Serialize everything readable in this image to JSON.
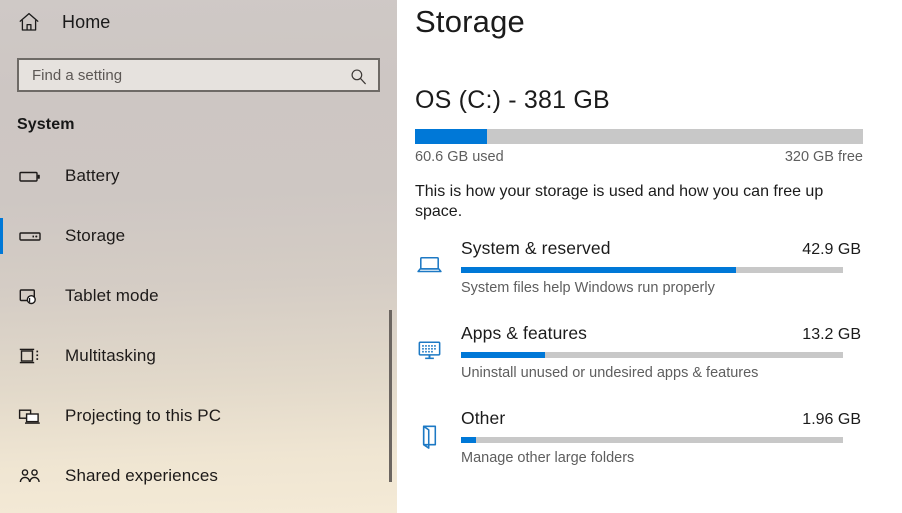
{
  "colors": {
    "accent": "#0078d7",
    "track": "#c8c8c8",
    "text": "#1b1b1b",
    "muted": "#5e5e5e"
  },
  "sidebar": {
    "home_label": "Home",
    "search": {
      "placeholder": "Find a setting",
      "value": ""
    },
    "section_title": "System",
    "items": [
      {
        "label": "Battery",
        "icon": "battery-icon",
        "selected": false
      },
      {
        "label": "Storage",
        "icon": "storage-icon",
        "selected": true
      },
      {
        "label": "Tablet mode",
        "icon": "tablet-mode-icon",
        "selected": false
      },
      {
        "label": "Multitasking",
        "icon": "multitasking-icon",
        "selected": false
      },
      {
        "label": "Projecting to this PC",
        "icon": "projecting-icon",
        "selected": false
      },
      {
        "label": "Shared experiences",
        "icon": "shared-icon",
        "selected": false
      }
    ]
  },
  "content": {
    "page_title": "Storage",
    "drive": {
      "title": "OS (C:) - 381 GB",
      "used_label": "60.6 GB used",
      "free_label": "320 GB free",
      "fill_percent": 16
    },
    "blurb": "This is how your storage is used and how you can free up space.",
    "categories": [
      {
        "name": "System & reserved",
        "size": "42.9 GB",
        "description": "System files help Windows run properly",
        "fill_percent": 72,
        "icon": "laptop-icon"
      },
      {
        "name": "Apps & features",
        "size": "13.2 GB",
        "description": "Uninstall unused or undesired apps & features",
        "fill_percent": 22,
        "icon": "apps-monitor-icon"
      },
      {
        "name": "Other",
        "size": "1.96 GB",
        "description": "Manage other large folders",
        "fill_percent": 4,
        "icon": "folder-icon"
      }
    ]
  }
}
